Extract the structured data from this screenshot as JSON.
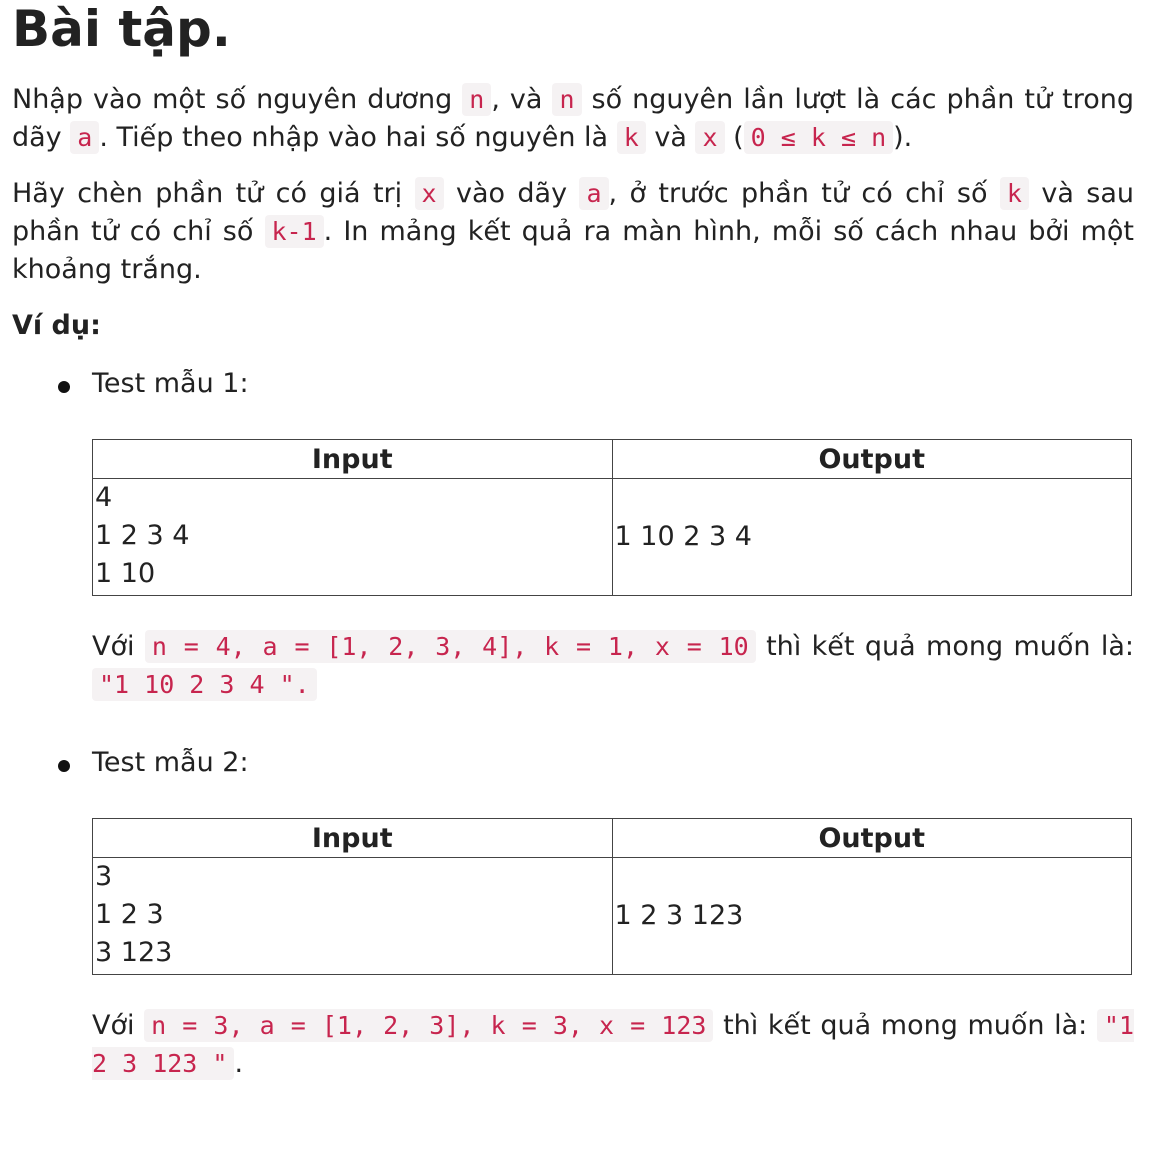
{
  "title": "Bài tập.",
  "paragraph1": {
    "t1": "Nhập vào một số nguyên dương ",
    "c1": "n",
    "t2": ", và ",
    "c2": "n",
    "t3": " số nguyên lần lượt là các phần tử trong dãy ",
    "c3": "a",
    "t4": ". Tiếp theo nhập vào hai số nguyên là ",
    "c4": "k",
    "t5": " và ",
    "c5": "x",
    "t6": " (",
    "c6": "0 ≤ k ≤ n",
    "t7": ")."
  },
  "paragraph2": {
    "t1": "Hãy chèn phần tử có giá trị ",
    "c1": "x",
    "t2": " vào dãy ",
    "c2": "a",
    "t3": ", ở trước phần tử có chỉ số ",
    "c3": "k",
    "t4": " và sau phần tử có chỉ số ",
    "c4": "k-1",
    "t5": ". In mảng kết quả ra màn hình, mỗi số cách nhau bởi một khoảng trắng."
  },
  "example_heading": "Ví dụ:",
  "tests": [
    {
      "label": "Test mẫu 1:",
      "header_input": "Input",
      "header_output": "Output",
      "input_lines": [
        "4",
        "1 2 3 4",
        "1 10"
      ],
      "output": "1 10 2 3 4",
      "explain_prefix": "Với ",
      "explain_code": "n = 4, a = [1, 2, 3, 4], k = 1, x = 10",
      "explain_mid": " thì kết quả mong muốn là: ",
      "explain_result": "\"1 10 2 3 4 \".",
      "explain_suffix": ""
    },
    {
      "label": "Test mẫu 2:",
      "header_input": "Input",
      "header_output": "Output",
      "input_lines": [
        "3",
        "1 2 3",
        "3 123"
      ],
      "output": "1 2 3 123",
      "explain_prefix": "Với ",
      "explain_code": "n = 3, a = [1, 2, 3], k = 3, x = 123",
      "explain_mid": " thì kết quả mong muốn là: ",
      "explain_result": "\"1 2 3 123 \"",
      "explain_suffix": "."
    }
  ]
}
